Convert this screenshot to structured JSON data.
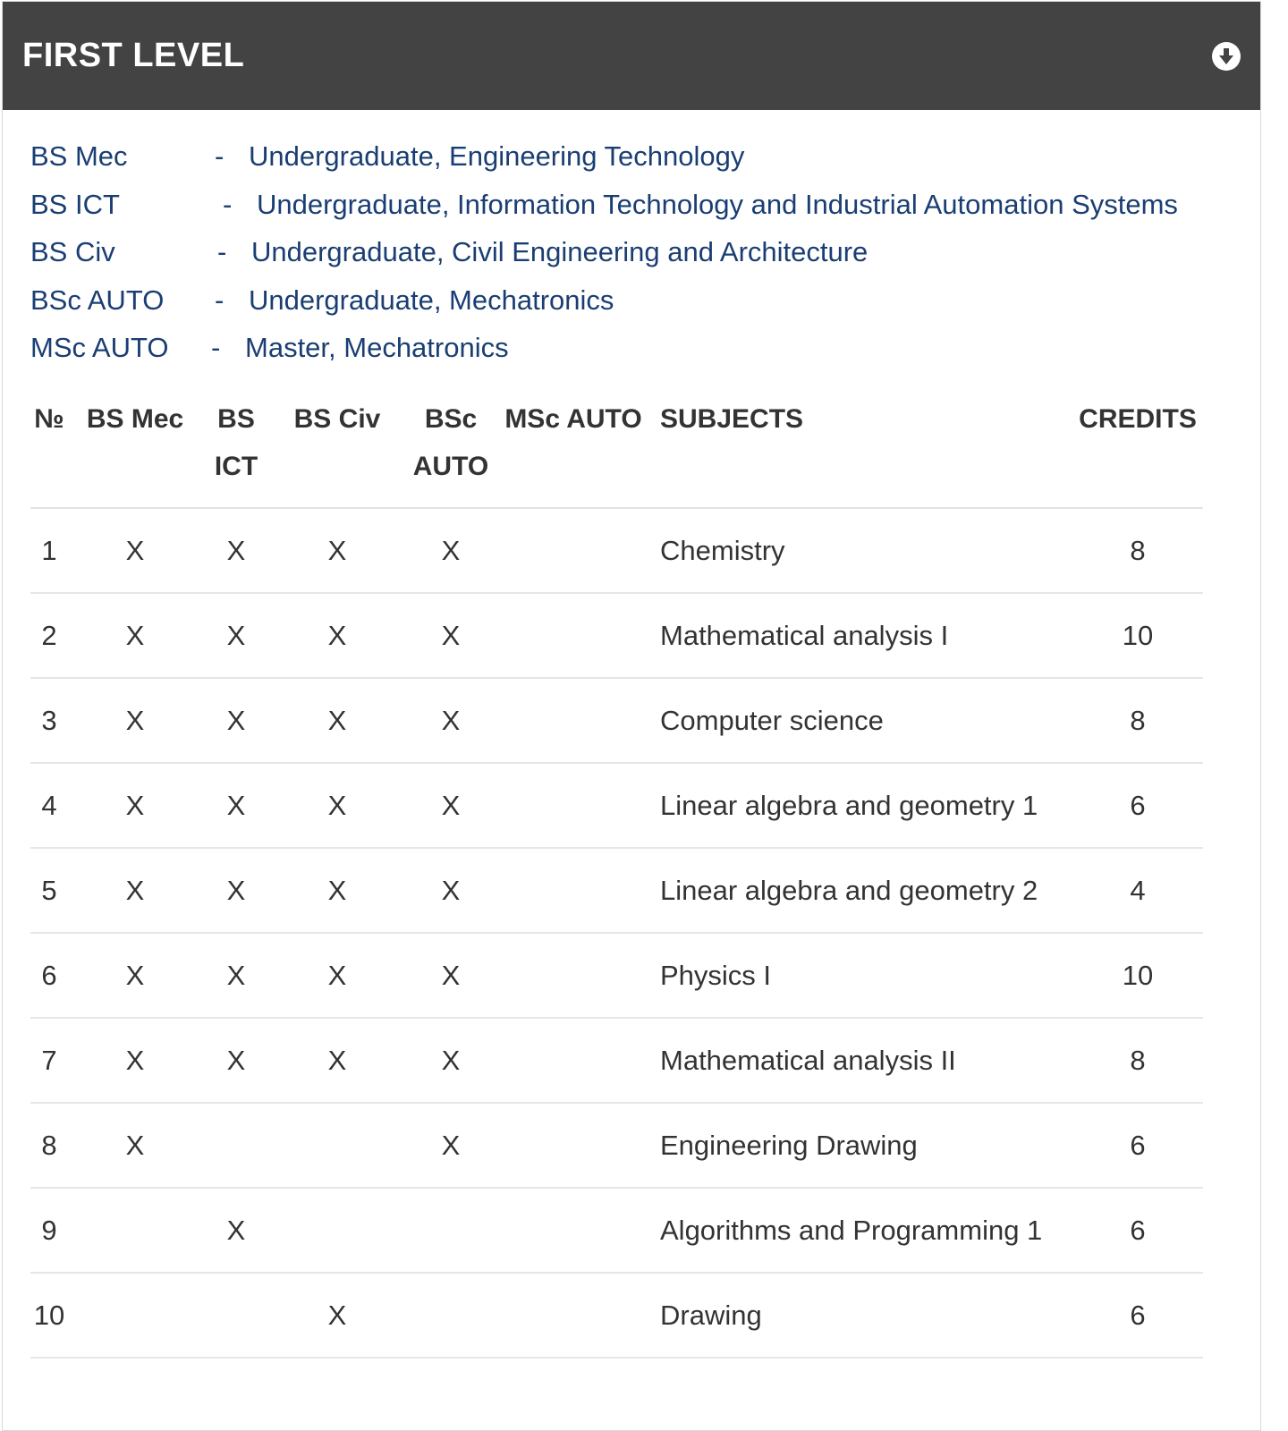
{
  "header": {
    "title": "FIRST LEVEL",
    "toggle_icon": "arrow-down-circle-icon"
  },
  "legend": [
    {
      "code": "BS Mec",
      "dash": "-",
      "description": "Undergraduate, Engineering Technology"
    },
    {
      "code": "BS ICT",
      "dash": "-",
      "description": "Undergraduate, Information Technology and Industrial Automation Systems"
    },
    {
      "code": "BS Civ",
      "dash": "-",
      "description": "Undergraduate, Civil Engineering and Architecture"
    },
    {
      "code": "BSc AUTO",
      "dash": "-",
      "description": "Undergraduate, Mechatronics"
    },
    {
      "code": "MSc AUTO",
      "dash": "-",
      "description": "Master, Mechatronics"
    }
  ],
  "table": {
    "columns": [
      "№",
      "BS Mec",
      "BS ICT",
      "BS Civ",
      "BSc AUTO",
      "MSc AUTO",
      "SUBJECTS",
      "CREDITS"
    ],
    "rows": [
      [
        "1",
        "X",
        "X",
        "X",
        "X",
        "",
        "Chemistry",
        "8"
      ],
      [
        "2",
        "X",
        "X",
        "X",
        "X",
        "",
        "Mathematical analysis I",
        "10"
      ],
      [
        "3",
        "X",
        "X",
        "X",
        "X",
        "",
        "Computer science",
        "8"
      ],
      [
        "4",
        "X",
        "X",
        "X",
        "X",
        "",
        "Linear algebra and geometry 1",
        "6"
      ],
      [
        "5",
        "X",
        "X",
        "X",
        "X",
        "",
        "Linear algebra and geometry 2",
        "4"
      ],
      [
        "6",
        "X",
        "X",
        "X",
        "X",
        "",
        "Physics I",
        "10"
      ],
      [
        "7",
        "X",
        "X",
        "X",
        "X",
        "",
        "Mathematical analysis II",
        "8"
      ],
      [
        "8",
        "X",
        "",
        "",
        "X",
        "",
        "Engineering Drawing",
        "6"
      ],
      [
        "9",
        "",
        "X",
        "",
        "",
        "",
        "Algorithms and Programming 1",
        "6"
      ],
      [
        "10",
        "",
        "",
        "X",
        "",
        "",
        "Drawing",
        "6"
      ]
    ]
  }
}
